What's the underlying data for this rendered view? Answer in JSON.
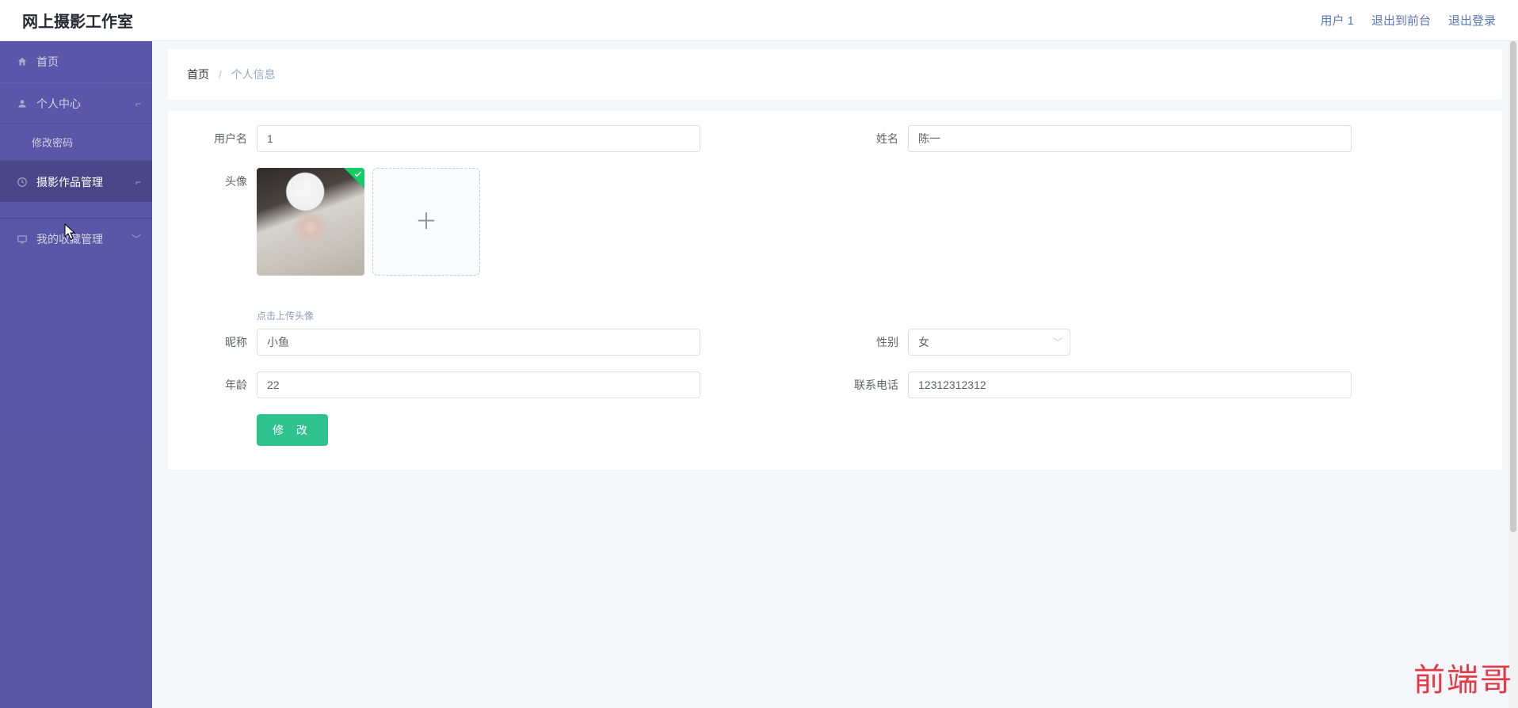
{
  "header": {
    "brand": "网上摄影工作室",
    "user_label": "用户 1",
    "back_to_front": "退出到前台",
    "logout": "退出登录"
  },
  "sidebar": {
    "items": [
      {
        "label": "首页",
        "icon": "home"
      },
      {
        "label": "个人中心",
        "icon": "user",
        "expand": "up"
      },
      {
        "label": "摄影作品管理",
        "icon": "clock",
        "expand": "up"
      },
      {
        "label": "我的收藏管理",
        "icon": "monitor",
        "expand": "down"
      }
    ],
    "sub_password": "修改密码"
  },
  "breadcrumb": {
    "home": "首页",
    "current": "个人信息"
  },
  "form": {
    "labels": {
      "username": "用户名",
      "name": "姓名",
      "avatar": "头像",
      "nickname": "昵称",
      "gender": "性别",
      "age": "年龄",
      "phone": "联系电话"
    },
    "values": {
      "username": "1",
      "name": "陈一",
      "nickname": "小鱼",
      "gender": "女",
      "age": "22",
      "phone": "12312312312"
    },
    "upload_hint": "点击上传头像",
    "submit_label": "修 改"
  },
  "watermark": "前端哥"
}
